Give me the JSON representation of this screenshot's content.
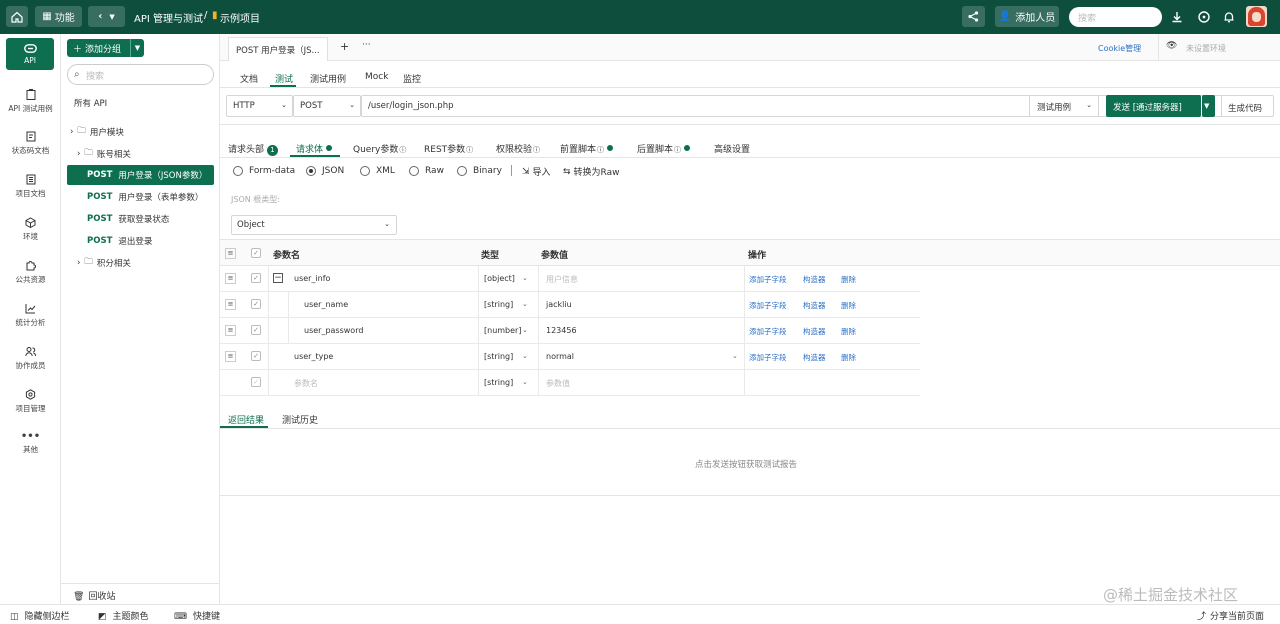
{
  "topbar": {
    "function_label": "功能",
    "breadcrumb_api": "API 管理与测试",
    "breadcrumb_sep": "/",
    "project": "示例项目",
    "add_member": "添加人员",
    "search_placeholder": "搜索"
  },
  "nav": [
    {
      "label": "API",
      "icon": "link-icon"
    },
    {
      "label": "API 测试用例",
      "icon": "clipboard-icon"
    },
    {
      "label": "状态码文档",
      "icon": "doc-icon"
    },
    {
      "label": "项目文档",
      "icon": "book-icon"
    },
    {
      "label": "环境",
      "icon": "cube-icon"
    },
    {
      "label": "公共资源",
      "icon": "puzzle-icon"
    },
    {
      "label": "统计分析",
      "icon": "chart-icon"
    },
    {
      "label": "协作成员",
      "icon": "users-icon"
    },
    {
      "label": "项目管理",
      "icon": "gear-icon"
    },
    {
      "label": "其他",
      "icon": "more-icon"
    }
  ],
  "tree": {
    "add_group": "添加分组",
    "search_placeholder": "搜索",
    "all_api": "所有 API",
    "items": [
      {
        "label": "用户模块",
        "type": "folder"
      },
      {
        "label": "账号相关",
        "type": "folder"
      },
      {
        "method": "POST",
        "label": "用户登录（JSON参数）",
        "selected": true
      },
      {
        "method": "POST",
        "label": "用户登录（表单参数）"
      },
      {
        "method": "POST",
        "label": "获取登录状态"
      },
      {
        "method": "POST",
        "label": "退出登录"
      },
      {
        "label": "积分相关",
        "type": "folder"
      }
    ],
    "recycle": "回收站"
  },
  "tabbar": {
    "tab": "POST 用户登录（JSON参数）",
    "tab_display": "POST 用户登录（JS...",
    "plus": "+",
    "more": "···",
    "cookie": "Cookie管理",
    "env": "未设置环境"
  },
  "subtabs": [
    "文档",
    "测试",
    "测试用例",
    "Mock",
    "监控"
  ],
  "request": {
    "protocol": "HTTP",
    "method": "POST",
    "url": "/user/login_json.php",
    "test_case": "测试用例",
    "send": "发送 [通过服务器]",
    "gen_code": "生成代码"
  },
  "param_tabs": [
    {
      "label": "请求头部",
      "badge": "1"
    },
    {
      "label": "请求体",
      "dot": true
    },
    {
      "label": "Query参数"
    },
    {
      "label": "REST参数"
    },
    {
      "label": "权限校验"
    },
    {
      "label": "前置脚本",
      "dot": true
    },
    {
      "label": "后置脚本",
      "dot": true
    },
    {
      "label": "高级设置"
    }
  ],
  "body_types": [
    "Form-data",
    "JSON",
    "XML",
    "Raw",
    "Binary"
  ],
  "body_selected": "JSON",
  "import": "导入",
  "to_raw": "转换为Raw",
  "json_root_label": "JSON 根类型:",
  "json_root": "Object",
  "table": {
    "headers": [
      "参数名",
      "类型",
      "参数值",
      "操作"
    ],
    "rows": [
      {
        "name": "user_info",
        "type": "[object]",
        "value": "用户信息",
        "placeholder_value": true,
        "collapse": "−"
      },
      {
        "name": "user_name",
        "type": "[string]",
        "value": "jackliu",
        "child": true
      },
      {
        "name": "user_password",
        "type": "[number]",
        "value": "123456",
        "child": true
      },
      {
        "name": "user_type",
        "type": "[string]",
        "value": "normal",
        "has_dd": true
      },
      {
        "name": "参数名",
        "type": "[string]",
        "value": "参数值",
        "empty": true
      }
    ],
    "actions": [
      "添加子字段",
      "构造器",
      "删除"
    ]
  },
  "result_tabs": [
    "返回结果",
    "测试历史"
  ],
  "result_empty": "点击发送按钮获取测试报告",
  "bottom": {
    "hide_sidebar": "隐藏侧边栏",
    "theme": "主题颜色",
    "shortcut": "快捷键",
    "share": "分享当前页面"
  },
  "watermark": "@稀土掘金技术社区"
}
